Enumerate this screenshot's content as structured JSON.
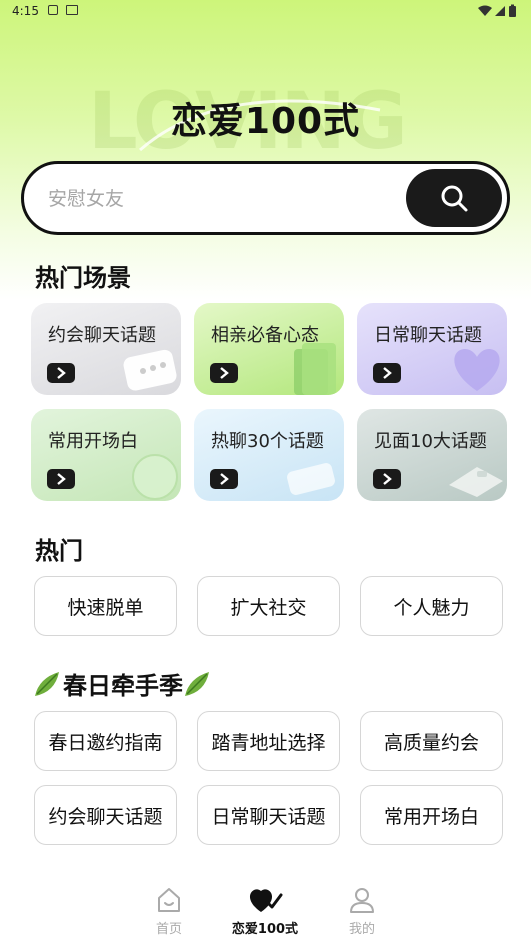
{
  "status_bar": {
    "time": "4:15"
  },
  "hero": {
    "title": "恋爱100式",
    "watermark": "LOVING"
  },
  "search": {
    "placeholder": "安慰女友"
  },
  "hot_scenes": {
    "title": "热门场景",
    "cards": [
      {
        "label": "约会聊天话题",
        "color": "#e4e4e8"
      },
      {
        "label": "相亲必备心态",
        "color": "#c8ef9a"
      },
      {
        "label": "日常聊天话题",
        "color": "#d6d0f6"
      },
      {
        "label": "常用开场白",
        "color": "#cfe9c4"
      },
      {
        "label": "热聊30个话题",
        "color": "#d8edf8"
      },
      {
        "label": "见面10大话题",
        "color": "#c9d6d2"
      }
    ]
  },
  "hot": {
    "title": "热门",
    "pills": [
      "快速脱单",
      "扩大社交",
      "个人魅力"
    ]
  },
  "spring": {
    "title": "春日牵手季",
    "pills": [
      "春日邀约指南",
      "踏青地址选择",
      "高质量约会",
      "约会聊天话题",
      "日常聊天话题",
      "常用开场白"
    ]
  },
  "bottom_nav": {
    "items": [
      {
        "label": "首页"
      },
      {
        "label": "恋爱100式"
      },
      {
        "label": "我的"
      }
    ]
  }
}
